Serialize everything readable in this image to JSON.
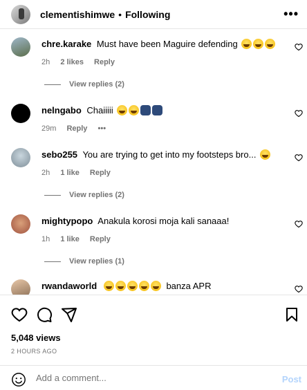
{
  "header": {
    "username": "clementishimwe",
    "separator": "•",
    "follow_label": "Following"
  },
  "comments": [
    {
      "username": "chre.karake",
      "text": "Must have been Maguire defending",
      "emojis": [
        "laugh",
        "laugh",
        "laugh"
      ],
      "time": "2h",
      "likes": "2 likes",
      "reply": "Reply",
      "view_replies": "View replies (2)"
    },
    {
      "username": "nelngabo",
      "text": "Chaiiiii",
      "emojis": [
        "laugh",
        "laugh",
        "hand",
        "hand"
      ],
      "time": "29m",
      "likes": "",
      "reply": "Reply",
      "more": "•••",
      "view_replies": ""
    },
    {
      "username": "sebo255",
      "text": "You are trying to get into my footsteps bro...",
      "emojis": [
        "laugh"
      ],
      "time": "2h",
      "likes": "1 like",
      "reply": "Reply",
      "view_replies": "View replies (2)"
    },
    {
      "username": "mightypopo",
      "text": "Anakula korosi moja kali sanaaa!",
      "emojis": [],
      "time": "1h",
      "likes": "1 like",
      "reply": "Reply",
      "view_replies": "View replies (1)"
    },
    {
      "username": "rwandaworld",
      "text": "banza APR",
      "emojis": [
        "laugh",
        "laugh",
        "laugh",
        "laugh",
        "laugh"
      ],
      "time": "",
      "likes": "",
      "reply": "",
      "view_replies": ""
    }
  ],
  "stats": {
    "views": "5,048 views",
    "time_ago": "2 HOURS AGO"
  },
  "add_comment": {
    "placeholder": "Add a comment...",
    "post_label": "Post"
  }
}
